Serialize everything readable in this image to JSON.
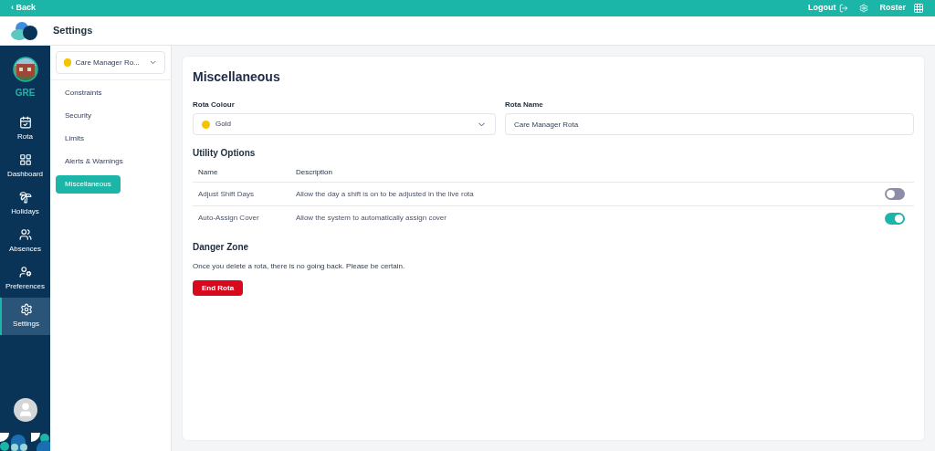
{
  "top_bar": {
    "back": "‹ Back",
    "logout": "Logout",
    "app": "Roster"
  },
  "header": {
    "title": "Settings"
  },
  "nav": {
    "site": "GRE",
    "items": [
      {
        "label": "Rota",
        "kind": "calendar",
        "selected": false
      },
      {
        "label": "Dashboard",
        "kind": "grid",
        "selected": false
      },
      {
        "label": "Holidays",
        "kind": "beach",
        "selected": false
      },
      {
        "label": "Absences",
        "kind": "people",
        "selected": false
      },
      {
        "label": "Preferences",
        "kind": "usergear",
        "selected": false
      },
      {
        "label": "Settings",
        "kind": "gear",
        "selected": true
      }
    ]
  },
  "rota_select": {
    "value": "Care Manager Ro...",
    "color": "#f5c400"
  },
  "settings_menu": [
    {
      "label": "Constraints",
      "selected": false
    },
    {
      "label": "Security",
      "selected": false
    },
    {
      "label": "Limits",
      "selected": false
    },
    {
      "label": "Alerts & Warnings",
      "selected": false
    },
    {
      "label": "Miscellaneous",
      "selected": true
    }
  ],
  "panel": {
    "title": "Miscellaneous",
    "colour_label": "Rota Colour",
    "colour_value": "Gold",
    "color": "#f5c400",
    "name_label": "Rota Name",
    "name_value": "Care Manager Rota",
    "utility_title": "Utility Options",
    "columns": [
      "Name",
      "Description"
    ],
    "options": [
      {
        "name": "Adjust Shift Days",
        "description": "Allow the day a shift is on to be adjusted in the live rota",
        "on": false
      },
      {
        "name": "Auto-Assign Cover",
        "description": "Allow the system to automatically assign cover",
        "on": true
      }
    ],
    "danger_title": "Danger Zone",
    "danger_text": "Once you delete a rota, there is no going back. Please be certain.",
    "danger_button": "End Rota"
  }
}
